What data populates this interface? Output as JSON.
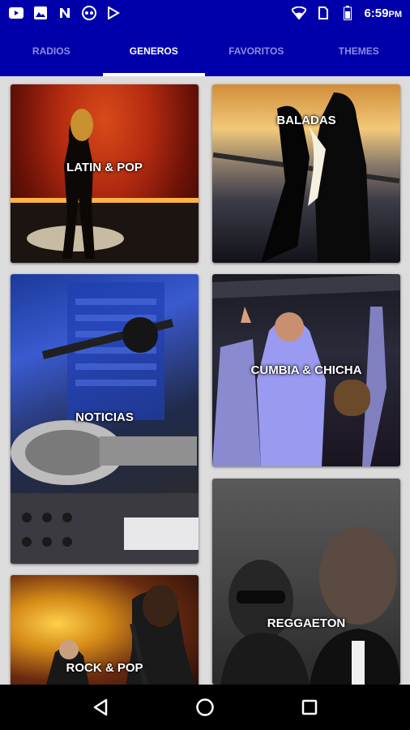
{
  "status_bar": {
    "time": "6:59",
    "time_suffix": "PM",
    "left_icons": [
      "youtube-icon",
      "image-icon",
      "n-app-icon",
      "headset-icon",
      "play-store-icon"
    ],
    "right_icons": [
      "wifi-icon",
      "sim-icon",
      "battery-icon"
    ]
  },
  "tabs": [
    {
      "label": "RADIOS",
      "active": false
    },
    {
      "label": "GENEROS",
      "active": true
    },
    {
      "label": "FAVORITOS",
      "active": false
    },
    {
      "label": "THEMES",
      "active": false
    }
  ],
  "genres": [
    {
      "label": "LATIN & POP"
    },
    {
      "label": "BALADAS"
    },
    {
      "label": "NOTICIAS"
    },
    {
      "label": "CUMBIA & CHICHA"
    },
    {
      "label": "REGGAETON"
    },
    {
      "label": "ROCK & POP"
    }
  ],
  "colors": {
    "brand": "#0000aa",
    "tab_inactive": "#8c8ce0",
    "tab_active": "#ffffff"
  }
}
